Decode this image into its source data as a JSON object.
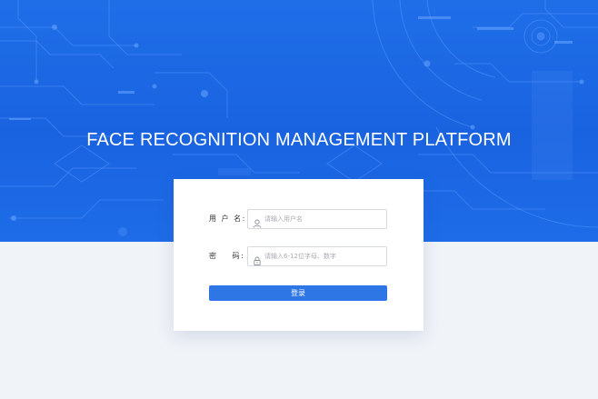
{
  "hero": {
    "title": "FACE RECOGNITION MANAGEMENT PLATFORM"
  },
  "login": {
    "username_label": "用 户 名:",
    "username_placeholder": "请输入用户名",
    "password_label": "密    码:",
    "password_placeholder": "请输入6-12位字母、数字",
    "submit_label": "登录"
  },
  "icons": {
    "username": "user-icon",
    "password": "lock-icon"
  },
  "colors": {
    "hero_blue": "#1a63e0",
    "page_background": "#f0f3f8",
    "button_blue": "#2e76e6"
  }
}
